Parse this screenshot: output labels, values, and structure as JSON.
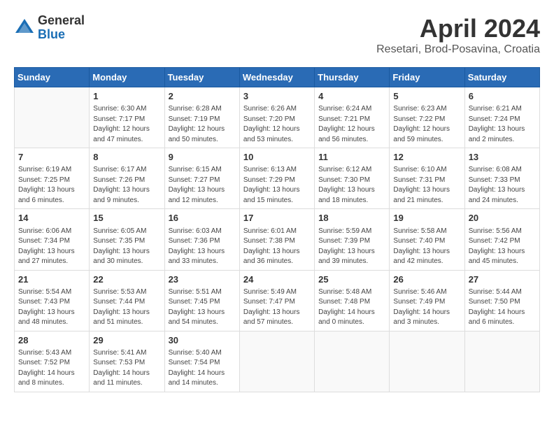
{
  "logo": {
    "general": "General",
    "blue": "Blue"
  },
  "header": {
    "title": "April 2024",
    "subtitle": "Resetari, Brod-Posavina, Croatia"
  },
  "weekdays": [
    "Sunday",
    "Monday",
    "Tuesday",
    "Wednesday",
    "Thursday",
    "Friday",
    "Saturday"
  ],
  "weeks": [
    [
      {
        "day": "",
        "info": ""
      },
      {
        "day": "1",
        "info": "Sunrise: 6:30 AM\nSunset: 7:17 PM\nDaylight: 12 hours\nand 47 minutes."
      },
      {
        "day": "2",
        "info": "Sunrise: 6:28 AM\nSunset: 7:19 PM\nDaylight: 12 hours\nand 50 minutes."
      },
      {
        "day": "3",
        "info": "Sunrise: 6:26 AM\nSunset: 7:20 PM\nDaylight: 12 hours\nand 53 minutes."
      },
      {
        "day": "4",
        "info": "Sunrise: 6:24 AM\nSunset: 7:21 PM\nDaylight: 12 hours\nand 56 minutes."
      },
      {
        "day": "5",
        "info": "Sunrise: 6:23 AM\nSunset: 7:22 PM\nDaylight: 12 hours\nand 59 minutes."
      },
      {
        "day": "6",
        "info": "Sunrise: 6:21 AM\nSunset: 7:24 PM\nDaylight: 13 hours\nand 2 minutes."
      }
    ],
    [
      {
        "day": "7",
        "info": "Sunrise: 6:19 AM\nSunset: 7:25 PM\nDaylight: 13 hours\nand 6 minutes."
      },
      {
        "day": "8",
        "info": "Sunrise: 6:17 AM\nSunset: 7:26 PM\nDaylight: 13 hours\nand 9 minutes."
      },
      {
        "day": "9",
        "info": "Sunrise: 6:15 AM\nSunset: 7:27 PM\nDaylight: 13 hours\nand 12 minutes."
      },
      {
        "day": "10",
        "info": "Sunrise: 6:13 AM\nSunset: 7:29 PM\nDaylight: 13 hours\nand 15 minutes."
      },
      {
        "day": "11",
        "info": "Sunrise: 6:12 AM\nSunset: 7:30 PM\nDaylight: 13 hours\nand 18 minutes."
      },
      {
        "day": "12",
        "info": "Sunrise: 6:10 AM\nSunset: 7:31 PM\nDaylight: 13 hours\nand 21 minutes."
      },
      {
        "day": "13",
        "info": "Sunrise: 6:08 AM\nSunset: 7:33 PM\nDaylight: 13 hours\nand 24 minutes."
      }
    ],
    [
      {
        "day": "14",
        "info": "Sunrise: 6:06 AM\nSunset: 7:34 PM\nDaylight: 13 hours\nand 27 minutes."
      },
      {
        "day": "15",
        "info": "Sunrise: 6:05 AM\nSunset: 7:35 PM\nDaylight: 13 hours\nand 30 minutes."
      },
      {
        "day": "16",
        "info": "Sunrise: 6:03 AM\nSunset: 7:36 PM\nDaylight: 13 hours\nand 33 minutes."
      },
      {
        "day": "17",
        "info": "Sunrise: 6:01 AM\nSunset: 7:38 PM\nDaylight: 13 hours\nand 36 minutes."
      },
      {
        "day": "18",
        "info": "Sunrise: 5:59 AM\nSunset: 7:39 PM\nDaylight: 13 hours\nand 39 minutes."
      },
      {
        "day": "19",
        "info": "Sunrise: 5:58 AM\nSunset: 7:40 PM\nDaylight: 13 hours\nand 42 minutes."
      },
      {
        "day": "20",
        "info": "Sunrise: 5:56 AM\nSunset: 7:42 PM\nDaylight: 13 hours\nand 45 minutes."
      }
    ],
    [
      {
        "day": "21",
        "info": "Sunrise: 5:54 AM\nSunset: 7:43 PM\nDaylight: 13 hours\nand 48 minutes."
      },
      {
        "day": "22",
        "info": "Sunrise: 5:53 AM\nSunset: 7:44 PM\nDaylight: 13 hours\nand 51 minutes."
      },
      {
        "day": "23",
        "info": "Sunrise: 5:51 AM\nSunset: 7:45 PM\nDaylight: 13 hours\nand 54 minutes."
      },
      {
        "day": "24",
        "info": "Sunrise: 5:49 AM\nSunset: 7:47 PM\nDaylight: 13 hours\nand 57 minutes."
      },
      {
        "day": "25",
        "info": "Sunrise: 5:48 AM\nSunset: 7:48 PM\nDaylight: 14 hours\nand 0 minutes."
      },
      {
        "day": "26",
        "info": "Sunrise: 5:46 AM\nSunset: 7:49 PM\nDaylight: 14 hours\nand 3 minutes."
      },
      {
        "day": "27",
        "info": "Sunrise: 5:44 AM\nSunset: 7:50 PM\nDaylight: 14 hours\nand 6 minutes."
      }
    ],
    [
      {
        "day": "28",
        "info": "Sunrise: 5:43 AM\nSunset: 7:52 PM\nDaylight: 14 hours\nand 8 minutes."
      },
      {
        "day": "29",
        "info": "Sunrise: 5:41 AM\nSunset: 7:53 PM\nDaylight: 14 hours\nand 11 minutes."
      },
      {
        "day": "30",
        "info": "Sunrise: 5:40 AM\nSunset: 7:54 PM\nDaylight: 14 hours\nand 14 minutes."
      },
      {
        "day": "",
        "info": ""
      },
      {
        "day": "",
        "info": ""
      },
      {
        "day": "",
        "info": ""
      },
      {
        "day": "",
        "info": ""
      }
    ]
  ]
}
